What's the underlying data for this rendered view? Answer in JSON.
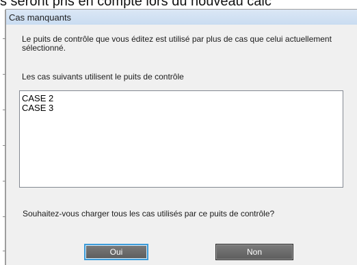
{
  "background": {
    "cut_text": "s seront pris en compte lors du nouveau calc"
  },
  "dialog": {
    "title": "Cas manquants",
    "message": "Le puits de contrôle que vous éditez est utilisé par plus de cas que celui actuellement sélectionné.",
    "list_label": "Les cas suivants utilisent le puits de contrôle",
    "cases": [
      "CASE 2",
      "CASE 3"
    ],
    "question": "Souhaitez-vous charger tous les cas utilisés par ce puits de contrôle?",
    "buttons": {
      "yes": "Oui",
      "no": "Non"
    }
  },
  "colors": {
    "titlebar": "#c9dcf1",
    "dialog_bg": "#f0f0f0",
    "button_bg": "#6a6a6a",
    "focus_border": "#3c9bd8"
  }
}
